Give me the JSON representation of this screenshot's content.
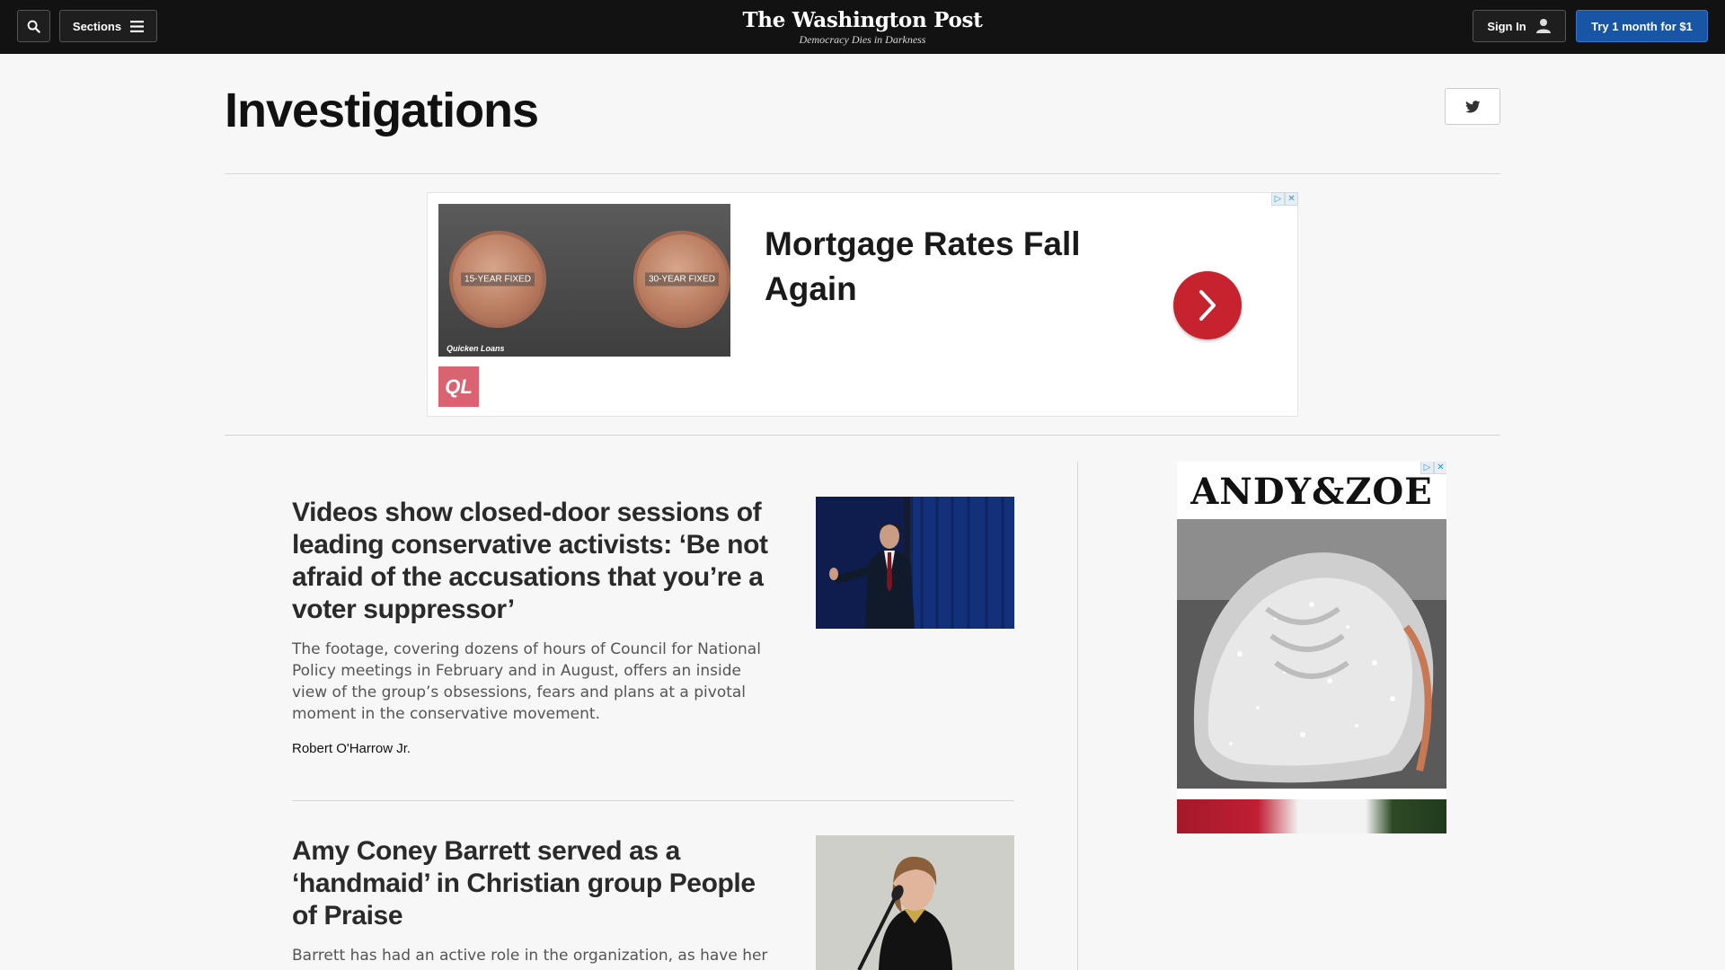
{
  "header": {
    "sections_label": "Sections",
    "logo_name": "The Washington Post",
    "logo_tagline": "Democracy Dies in Darkness",
    "signin_label": "Sign In",
    "subscribe_label": "Try 1 month for $1"
  },
  "page": {
    "title": "Investigations"
  },
  "ad_top": {
    "coin_left_label": "15-YEAR FIXED",
    "coin_right_label": "30-YEAR FIXED",
    "image_brand": "Quicken Loans",
    "headline": "Mortgage Rates Fall Again",
    "logo_text": "QL"
  },
  "articles": [
    {
      "headline": "Videos show closed-door sessions of leading conservative activists: ‘Be not afraid of the accusations that you’re a voter suppressor’",
      "blurb": "The footage, covering dozens of hours of Council for National Policy meetings in February and in August, offers an inside view of the group’s obsessions, fears and plans at a pivotal moment in the conservative movement.",
      "byline": "Robert O'Harrow Jr."
    },
    {
      "headline": "Amy Coney Barrett served as a ‘handmaid’ in Christian group People of Praise",
      "blurb": "Barrett has had an active role in the organization, as have her"
    }
  ],
  "ad_side": {
    "brand": "ANDY&ZOE"
  },
  "colors": {
    "topbar": "#121212",
    "subscribe_button": "#1955a5",
    "ad_arrow": "#c7232e"
  }
}
